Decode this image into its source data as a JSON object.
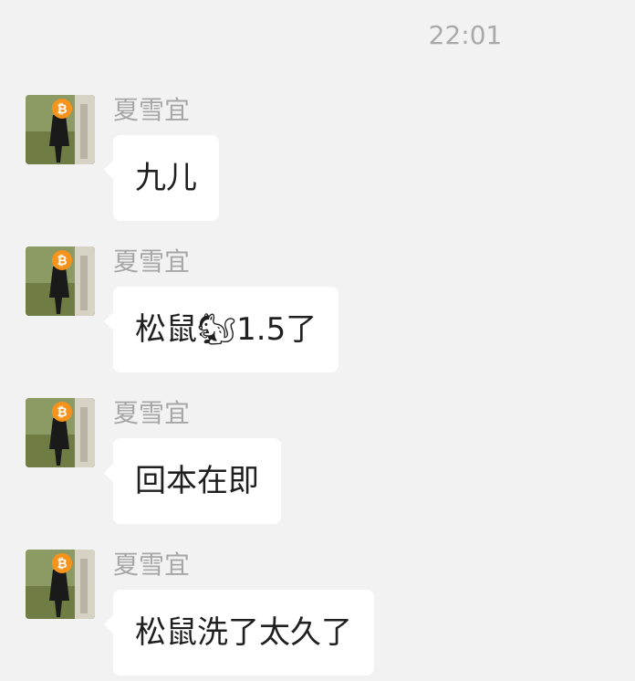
{
  "chat": {
    "timestamp": "22:01",
    "messages": [
      {
        "sender": "夏雪宜",
        "text": "九儿"
      },
      {
        "sender": "夏雪宜",
        "text": "松鼠🐿1.5了"
      },
      {
        "sender": "夏雪宜",
        "text": "回本在即"
      },
      {
        "sender": "夏雪宜",
        "text": "松鼠洗了太久了"
      }
    ]
  },
  "icons": {
    "avatar_badge": "bitcoin-icon"
  },
  "colors": {
    "background": "#f2f2f2",
    "bubble": "#ffffff",
    "meta_text": "#a6a6a6",
    "message_text": "#1f1f1f",
    "bitcoin_orange": "#f7931a"
  }
}
